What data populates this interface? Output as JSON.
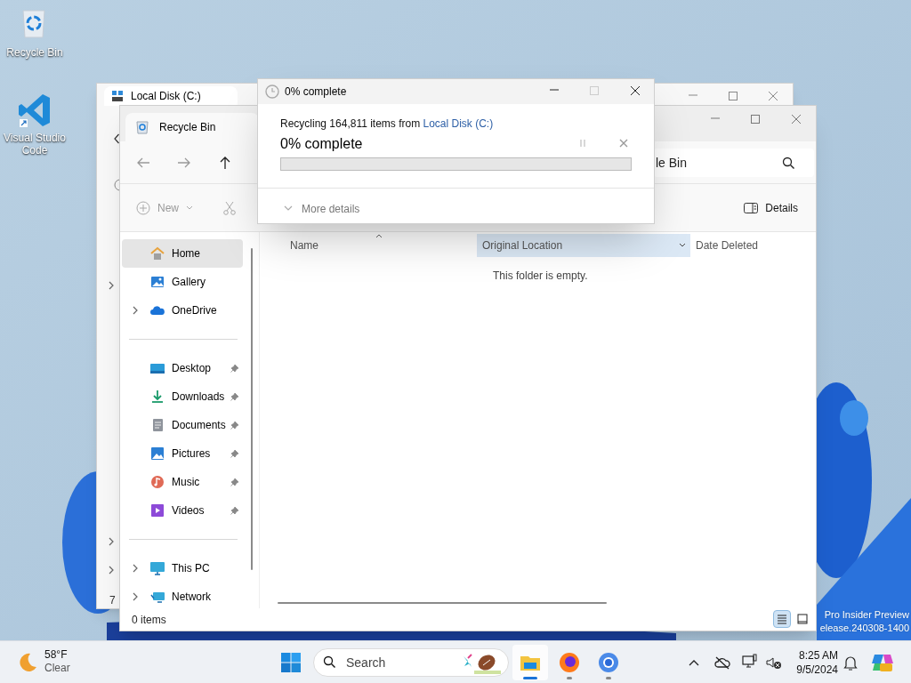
{
  "desktop_icons": [
    {
      "kind": "recycle",
      "label": "Recycle Bin"
    },
    {
      "kind": "vscode",
      "label": "Visual Studio Code"
    }
  ],
  "back_window": {
    "title": "Local Disk (C:)",
    "status": "7"
  },
  "explorer": {
    "tab_title": "Recycle Bin",
    "address": "le Bin",
    "new_label": "New",
    "view_label": "Details",
    "sidebar": [
      [
        {
          "kind": "home",
          "label": "Home",
          "selected": true,
          "expandable": false,
          "pinned": false
        },
        {
          "kind": "gallery",
          "label": "Gallery",
          "selected": false,
          "expandable": false,
          "pinned": false
        },
        {
          "kind": "cloud",
          "label": "OneDrive",
          "selected": false,
          "expandable": true,
          "pinned": false
        }
      ],
      [
        {
          "kind": "desktop",
          "label": "Desktop",
          "selected": false,
          "expandable": false,
          "pinned": true
        },
        {
          "kind": "download",
          "label": "Downloads",
          "selected": false,
          "expandable": false,
          "pinned": true
        },
        {
          "kind": "documents",
          "label": "Documents",
          "selected": false,
          "expandable": false,
          "pinned": true
        },
        {
          "kind": "pictures",
          "label": "Pictures",
          "selected": false,
          "expandable": false,
          "pinned": true
        },
        {
          "kind": "music",
          "label": "Music",
          "selected": false,
          "expandable": false,
          "pinned": true
        },
        {
          "kind": "videos",
          "label": "Videos",
          "selected": false,
          "expandable": false,
          "pinned": true
        }
      ],
      [
        {
          "kind": "pc",
          "label": "This PC",
          "selected": false,
          "expandable": true,
          "pinned": false
        },
        {
          "kind": "network",
          "label": "Network",
          "selected": false,
          "expandable": true,
          "pinned": false
        }
      ]
    ],
    "columns": [
      {
        "label": "Name",
        "sorted": true,
        "hovered": false
      },
      {
        "label": "Original Location",
        "sorted": false,
        "hovered": true
      },
      {
        "label": "Date Deleted",
        "sorted": false,
        "hovered": false
      }
    ],
    "empty_message": "This folder is empty.",
    "status": "0 items",
    "view_modes": [
      {
        "kind": "details",
        "selected": true
      },
      {
        "kind": "tiles",
        "selected": false
      }
    ]
  },
  "progress_dialog": {
    "title": "0% complete",
    "message": "Recycling 164,811 items from ",
    "source": "Local Disk (C:)",
    "heading": "0% complete",
    "details_toggle": "More details"
  },
  "build_info": [
    "Pro Insider Preview",
    "elease.240308-1400"
  ],
  "taskbar": {
    "weather": {
      "temperature": "58°F",
      "condition": "Clear"
    },
    "search_placeholder": "Search",
    "apps": [
      {
        "kind": "explorer",
        "active": true
      },
      {
        "kind": "firefox",
        "active": false
      },
      {
        "kind": "browser",
        "active": false
      }
    ],
    "time": "8:25 AM",
    "date": "9/5/2024"
  }
}
